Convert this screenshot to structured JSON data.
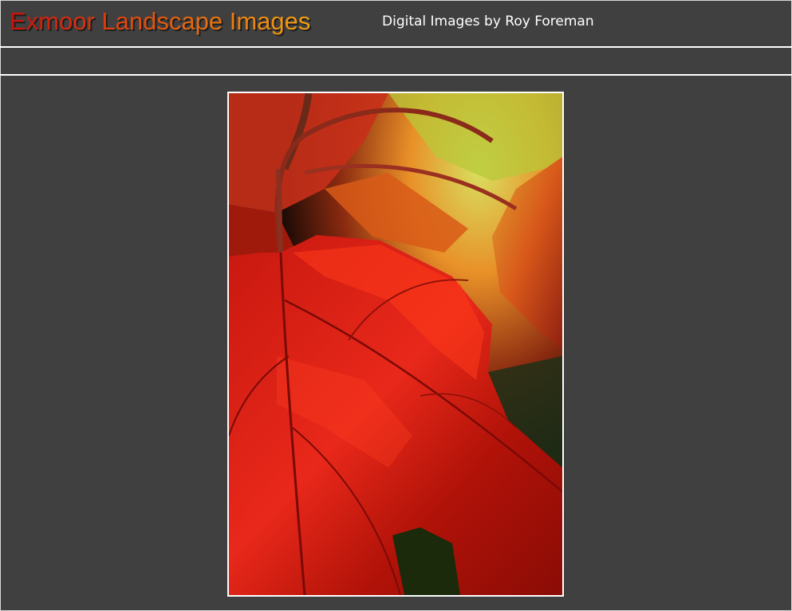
{
  "header": {
    "title": "Exmoor Landscape Images",
    "subtitle": "Digital Images by Roy Foreman"
  },
  "photo": {
    "subject": "red-autumn-leaf",
    "colors": {
      "leaf_red": "#d0180e",
      "leaf_dark": "#7a0a06",
      "highlight": "#ff3a1a",
      "foliage_orange": "#e8701a",
      "foliage_yellow": "#c8d040",
      "shadow": "#1a0a05"
    }
  },
  "theme": {
    "background": "#404040",
    "divider": "#ffffff"
  }
}
